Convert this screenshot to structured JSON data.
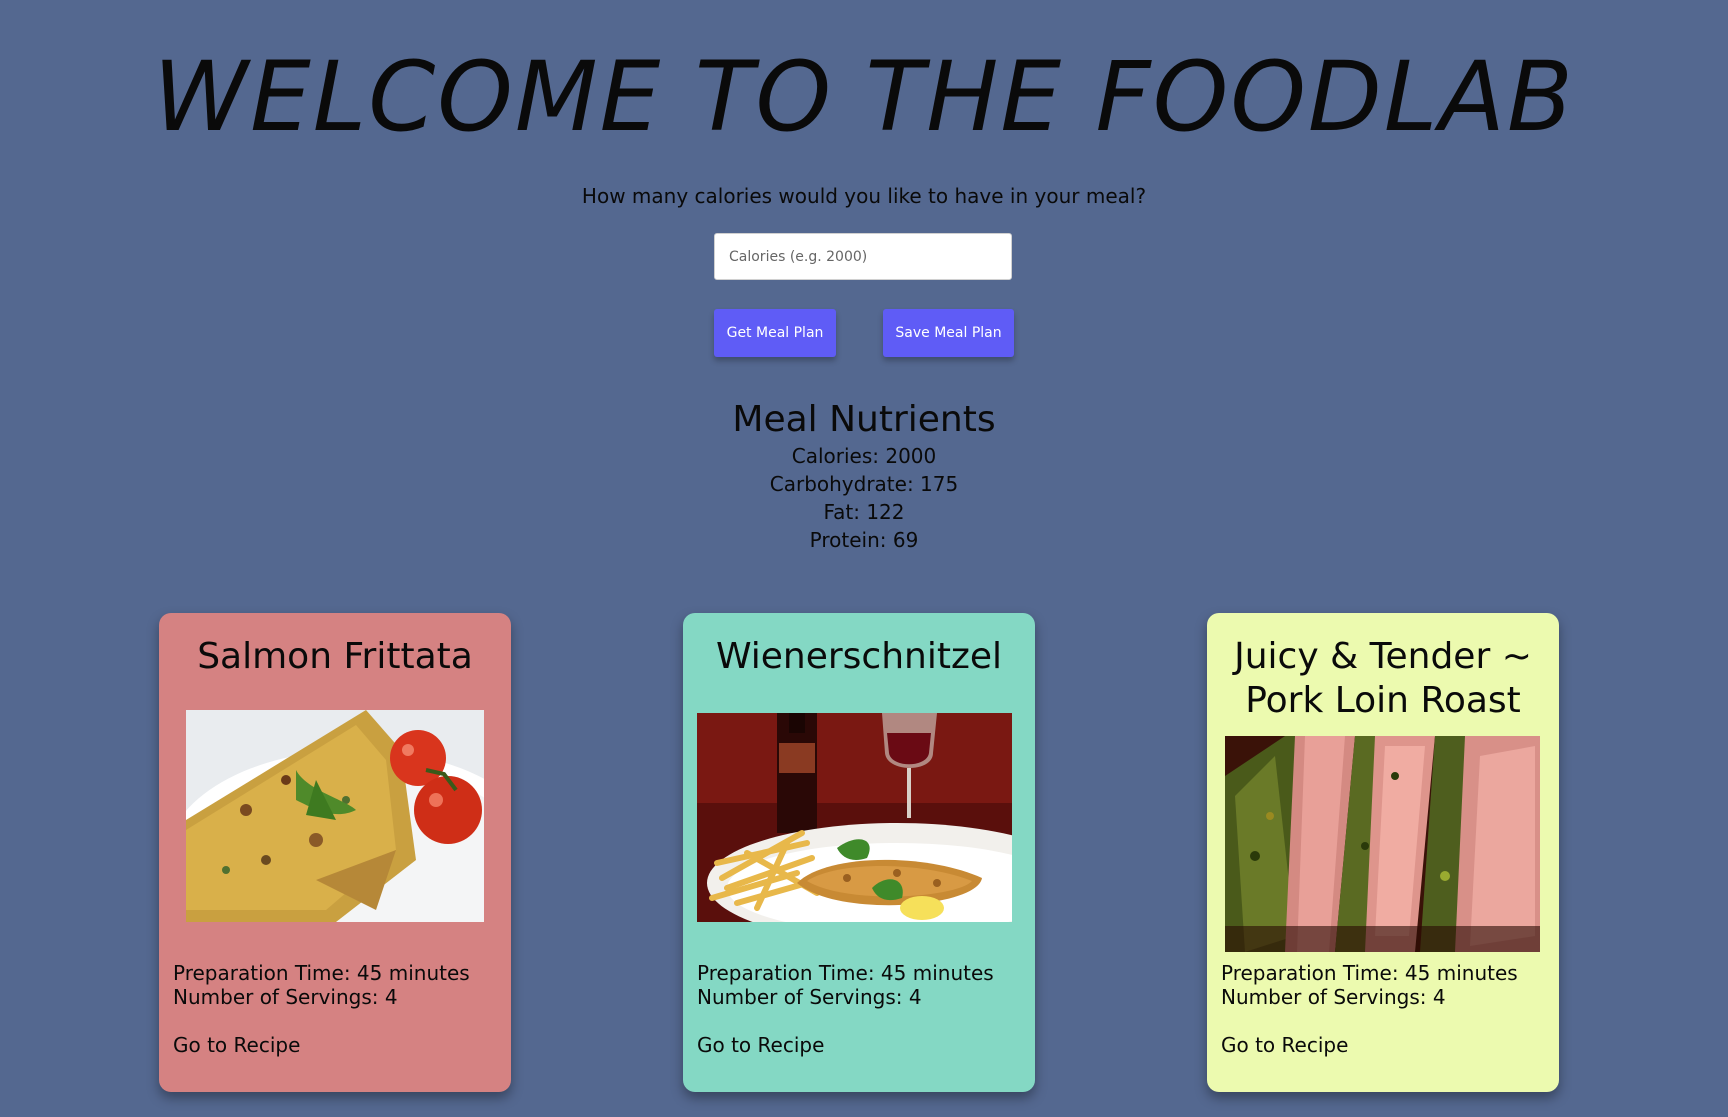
{
  "header": {
    "title": "WELCOME TO THE FOODLAB"
  },
  "form": {
    "question": "How many calories would you like to have in your meal?",
    "calories_placeholder": "Calories (e.g. 2000)",
    "calories_value": "",
    "get_button": "Get Meal Plan",
    "save_button": "Save Meal Plan"
  },
  "nutrients": {
    "heading": "Meal Nutrients",
    "calories": "Calories: 2000",
    "carbohydrate": "Carbohydrate: 175",
    "fat": "Fat: 122",
    "protein": "Protein: 69"
  },
  "meals": [
    {
      "title": "Salmon Frittata",
      "prep_time": "Preparation Time: 45 minutes",
      "servings": "Number of Servings: 4",
      "link": "Go to Recipe",
      "card_color": "#d58282"
    },
    {
      "title": "Wienerschnitzel",
      "prep_time": "Preparation Time: 45 minutes",
      "servings": "Number of Servings: 4",
      "link": "Go to Recipe",
      "card_color": "#84d8c4"
    },
    {
      "title": "Juicy & Tender ~ Pork Loin Roast",
      "prep_time": "Preparation Time: 45 minutes",
      "servings": "Number of Servings: 4",
      "link": "Go to Recipe",
      "card_color": "#ecfaaf"
    }
  ],
  "colors": {
    "background": "#546890",
    "button": "#5f5cf6"
  }
}
